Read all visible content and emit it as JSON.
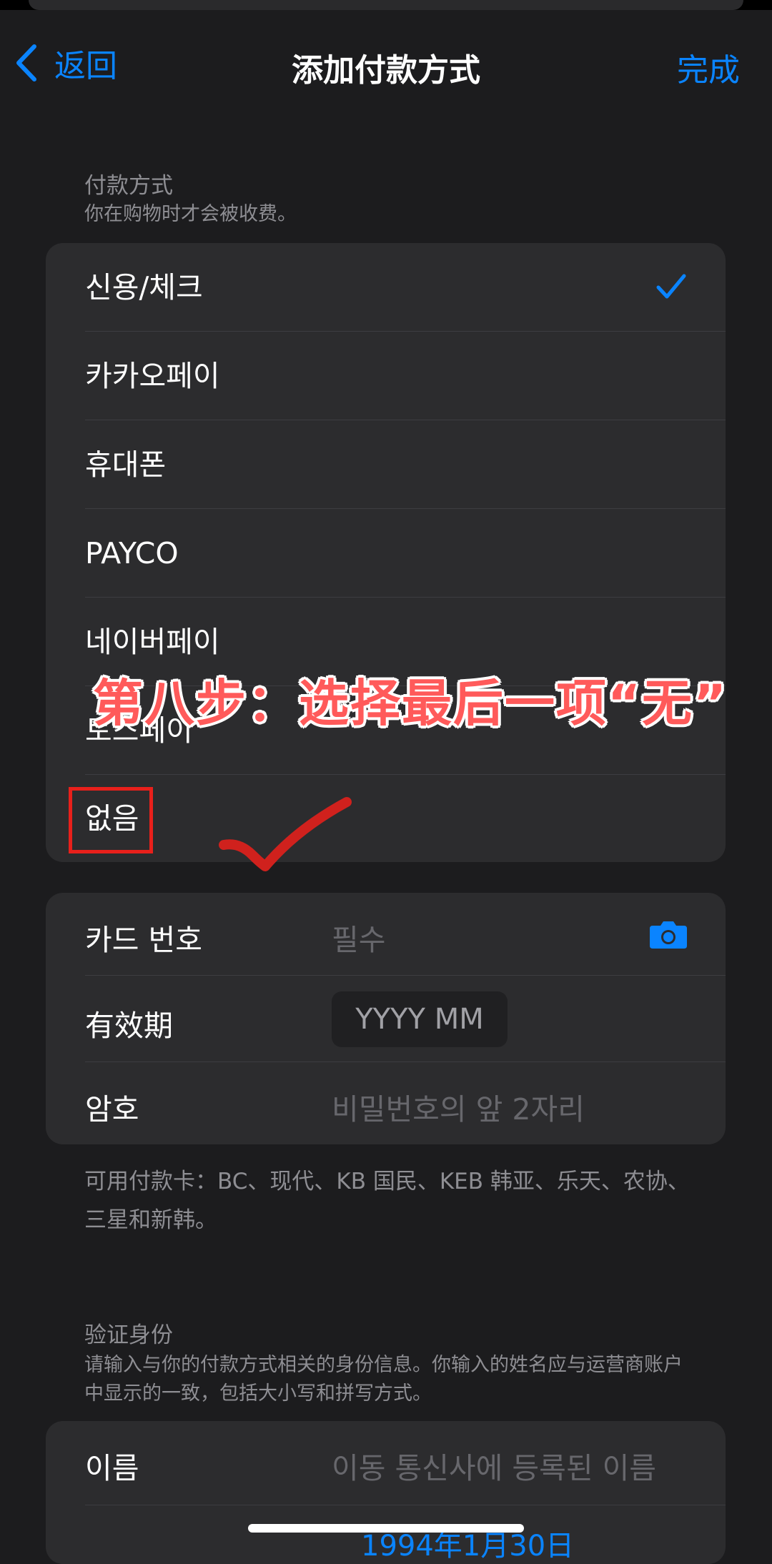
{
  "nav": {
    "back_label": "返回",
    "title": "添加付款方式",
    "done_label": "完成"
  },
  "payment_section": {
    "title": "付款方式",
    "subtitle": "你在购物时才会被收费。",
    "options": [
      "신용/체크",
      "카카오페이",
      "휴대폰",
      "PAYCO",
      "네이버페이",
      "토스페이",
      "없음"
    ],
    "selected_index": 0
  },
  "card_form": {
    "card_number": {
      "label": "카드 번호",
      "placeholder": "필수"
    },
    "expiry": {
      "label": "有效期",
      "placeholder": "YYYY MM"
    },
    "password": {
      "label": "암호",
      "placeholder": "비밀번호의 앞 2자리"
    }
  },
  "card_note": "可用付款卡：BC、现代、KB 国民、KEB 韩亚、乐天、农协、三星和新韩。",
  "identity_section": {
    "title": "验证身份",
    "subtitle": "请输入与你的付款方式相关的身份信息。你输入的姓名应与运营商账户中显示的一致，包括大小写和拼写方式。",
    "name": {
      "label": "이름",
      "placeholder": "이동 통신사에 등록된 이름"
    },
    "dob_partial": "1994年1月30日"
  },
  "annotation": {
    "instruction": "第八步：选择最后一项“无”"
  },
  "colors": {
    "accent": "#0a84ff",
    "background": "#1c1c1e",
    "group": "#2c2c2e",
    "annotation_red": "#e8201b"
  }
}
